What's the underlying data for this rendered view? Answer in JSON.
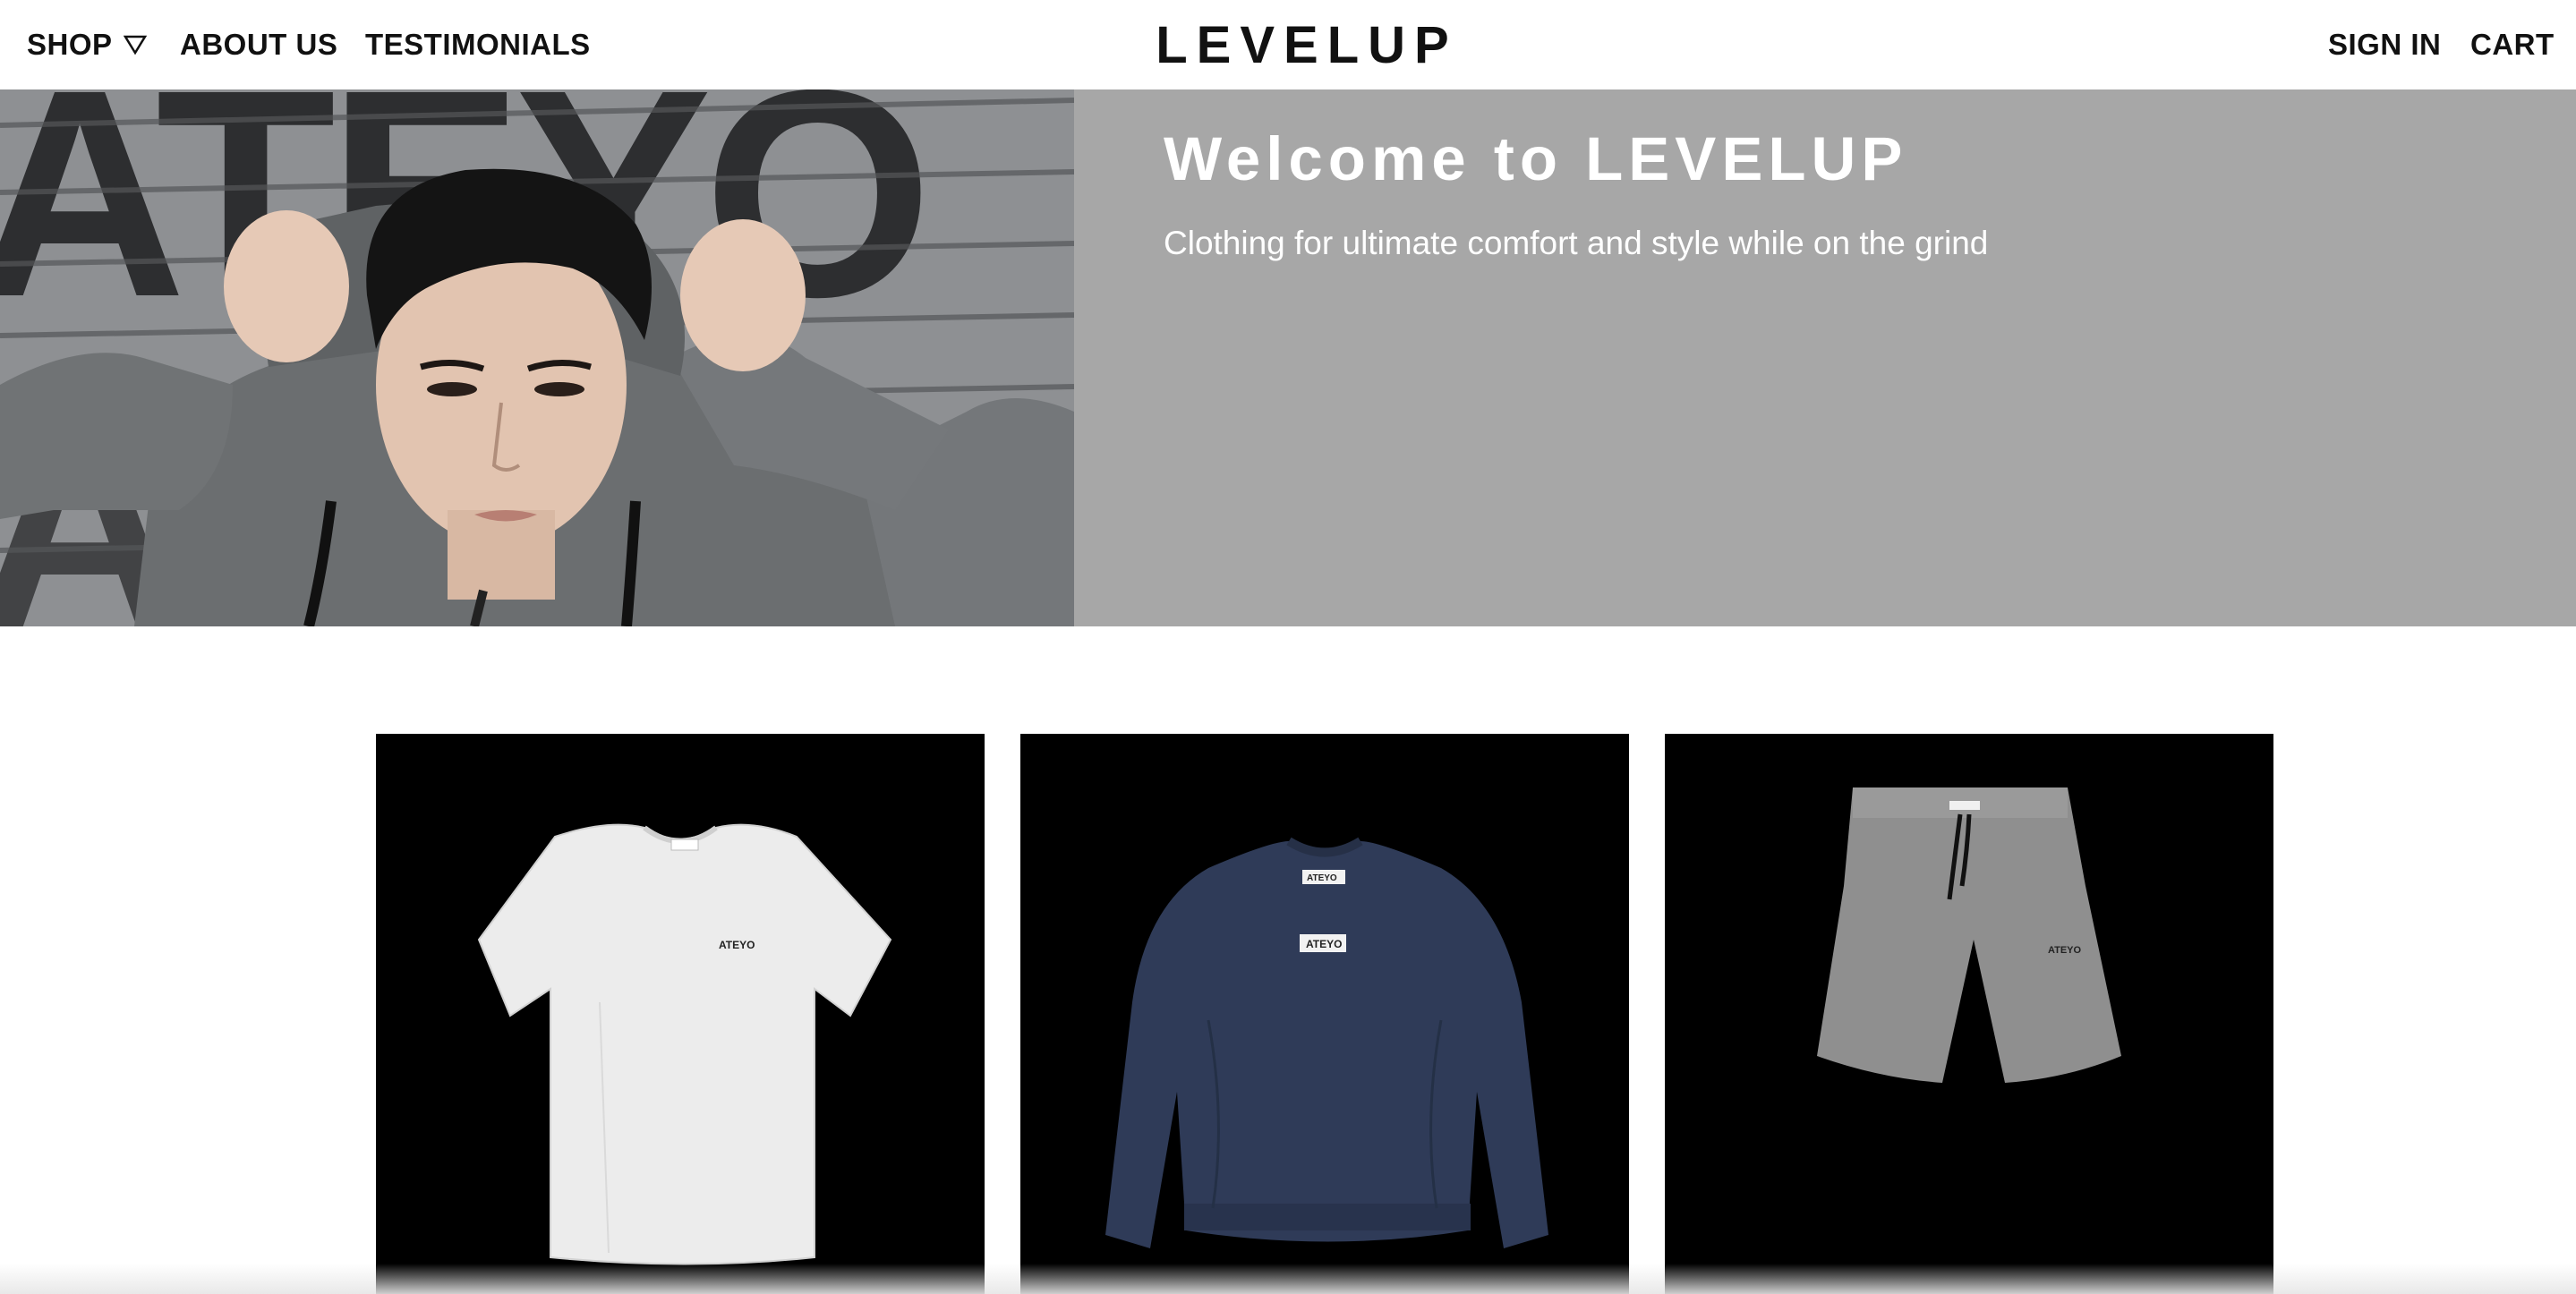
{
  "nav": {
    "shop_label": "SHOP",
    "about_label": "ABOUT US",
    "testimonials_label": "TESTIMONIALS",
    "logo": "LEVELUP",
    "signin_label": "SIGN IN",
    "cart_label": "CART"
  },
  "hero": {
    "title": "Welcome to LEVELUP",
    "subtitle": "Clothing for ultimate comfort and style while on the grind",
    "wall_lettering": "ATEYO",
    "background_color": "#a7a7a7"
  },
  "products": [
    {
      "name": "white-tshirt-image",
      "garment_label": "ATEYO",
      "garment_color": "#eeeeee"
    },
    {
      "name": "navy-sweatshirt-image",
      "garment_label": "ATEYO",
      "garment_color": "#2e3a55"
    },
    {
      "name": "grey-shorts-image",
      "garment_label": "ATEYO",
      "garment_color": "#8d8d8d"
    }
  ]
}
